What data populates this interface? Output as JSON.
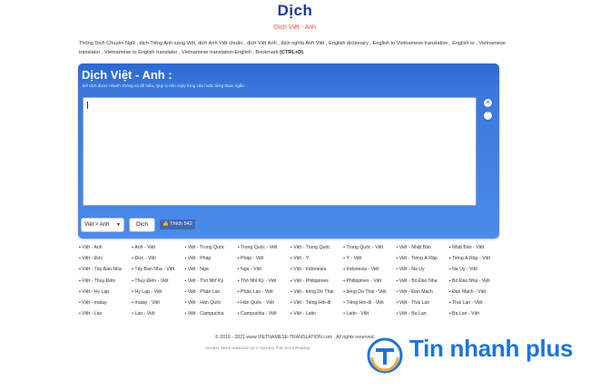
{
  "header": {
    "title": "Dịch",
    "subtitle": "Dịch Việt - Anh"
  },
  "keywords": {
    "text": "Thông Dịch Chuyên Ngữ , dịch Tiếng Anh sang Việt, dịch Anh Việt chuẩn , dịch Việt Anh , dịch nghĩa Anh Việt , English dictionary , English to Vietnamese translation , English to , Vietnamese translator , Vietnamese to English translator , Vietnamese translation English , Bookmark ",
    "shortcut": "(CTRL+D)"
  },
  "translator": {
    "heading": "Dịch Việt - Anh :",
    "hint": "Để dịch được nhanh chóng và dễ hiểu, Quý vị nên copy từng câu hoặc từng đoạn ngắn",
    "textarea_value": "",
    "clear_icon": "close-icon",
    "expand_icon": "chevron-down-icon",
    "language_select": "Việt > Anh",
    "translate_label": "Dịch",
    "like_label": "Thích",
    "like_count": "542"
  },
  "language_links": [
    "Việt - Anh",
    "Anh - Việt",
    "Việt - Trung Quốc",
    "Trung Quốc - Việt",
    "Việt - Trung Quốc",
    "Trung Quốc - Việt",
    "Việt - Nhật Bản",
    "Nhật Bản - Việt",
    "Việt - Đức",
    "Đức - Việt",
    "Việt - Pháp",
    "Pháp - Việt",
    "Việt - Ý",
    "Ý - Việt",
    "Việt - Tiếng Ả Rập",
    "Tiếng Ả Rập - Việt",
    "Việt - Tây Ban Nha",
    "Tây Ban Nha - Việt",
    "Việt - Nga",
    "Nga - Việt",
    "Việt - Indonesia",
    "Indonesia - Việt",
    "Việt - Na Uy",
    "Na Uy - Việt",
    "Việt - Thụy Điển",
    "Thụy Điển - Việt",
    "Việt - Thổ Nhĩ Kỳ",
    "Thổ Nhĩ Kỳ - Việt",
    "Việt - Philippines",
    "Philippines - Việt",
    "Việt - Bồ Đào Nha",
    "Bồ Đào Nha - Việt",
    "Việt - Hy Lạp",
    "Hy Lạp - Việt",
    "Việt - Phần Lan",
    "Phần Lan - Việt",
    "Việt - tiếng Do Thái",
    "tiếng Do Thái - Việt",
    "Việt - Đan Mạch",
    "Đan Mạch - Việt",
    "Việt - malay",
    "malay - Việt",
    "Việt - Hàn Quốc",
    "Hàn Quốc - Việt",
    "Việt - Tiếng Hin-đi",
    "Tiếng Hin-đi - Việt",
    "Việt - Thái Lan",
    "Thái Lan - Việt",
    "Việt - Lào",
    "Lào - Việt",
    "Việt - Campuchia",
    "Campuchia - Việt",
    "Việt - Latin",
    "Latin - Việt",
    "Việt - Ba Lan",
    "Ba Lan - Việt"
  ],
  "footer": {
    "copyright": "© 2010 - 2021 www.VIETNAMESE-TRANSLATION.com , All rights reserved.",
    "credit": "ขอบคุณ ชุดขอ เหตุผลอย่างมาก ขอบคุณ Tras Serot Reading"
  },
  "watermark": {
    "brand": "Tin nhanh plus",
    "brand_color": "#1f73d9"
  },
  "colors": {
    "panel_top": "#2d68cf",
    "panel_bottom": "#4b8bea",
    "title": "#1a3a9c",
    "subtitle": "#e0523a"
  }
}
